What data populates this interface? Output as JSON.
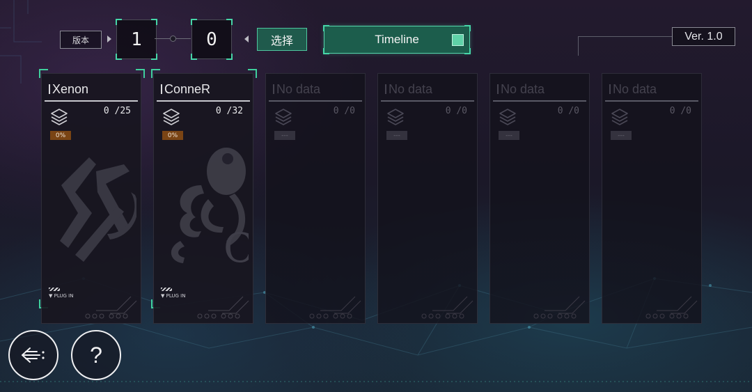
{
  "header": {
    "version_tag": "版本",
    "major_digit": "1",
    "minor_digit": "0",
    "select_label": "选择",
    "timeline_label": "Timeline",
    "version_label": "Ver. 1.0"
  },
  "cards": [
    {
      "name": "Xenon",
      "count": "0 /25",
      "percent": "0%",
      "plug_label": "▼ PLUG IN",
      "progress": 0
    },
    {
      "name": "ConneR",
      "count": "0 /32",
      "percent": "0%",
      "plug_label": "▼ PLUG IN",
      "progress": 0
    },
    {
      "name": "No data",
      "count": "0 /0",
      "percent": "---"
    },
    {
      "name": "No data",
      "count": "0 /0",
      "percent": "---"
    },
    {
      "name": "No data",
      "count": "0 /0",
      "percent": "---"
    },
    {
      "name": "No data",
      "count": "0 /0",
      "percent": "---"
    }
  ],
  "footer": {
    "help_label": "?"
  },
  "colors": {
    "accent": "#46d6a8",
    "button_fill": "#1c5d4c",
    "percent_badge": "#7a4414"
  },
  "icons": [
    "layers-icon",
    "back-arrow-icon",
    "help-icon",
    "timeline-icon"
  ]
}
